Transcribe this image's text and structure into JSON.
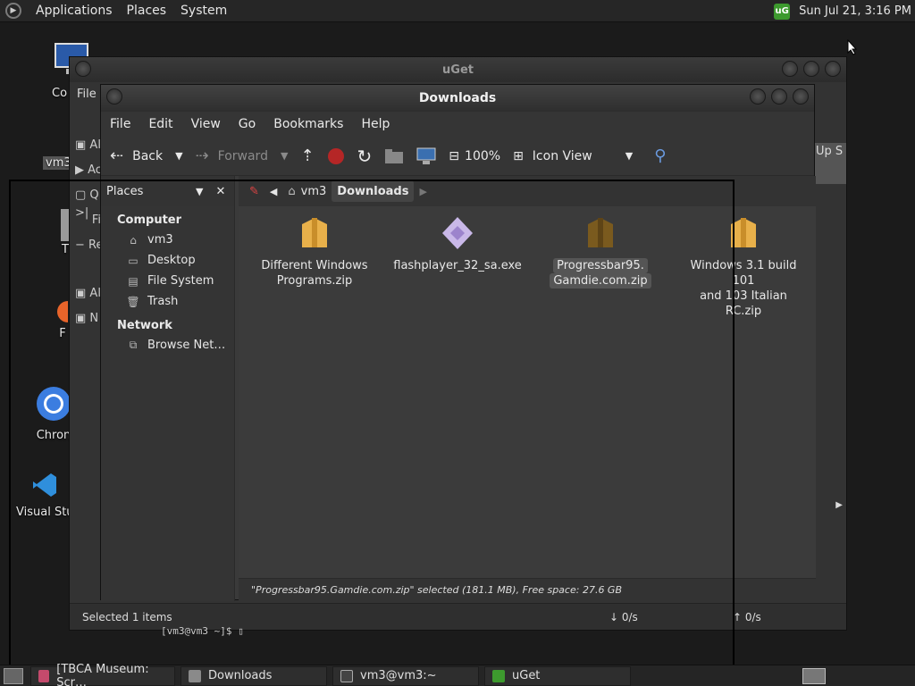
{
  "top_panel": {
    "menus": [
      "Applications",
      "Places",
      "System"
    ],
    "datetime": "Sun Jul 21,  3:16 PM",
    "tray_icon": "uget-icon"
  },
  "desktop": {
    "icons": [
      {
        "label": "Co",
        "icon": "computer-icon"
      },
      {
        "label": "vm3",
        "icon": "home-folder-icon"
      },
      {
        "label": "T",
        "icon": "trash-icon"
      },
      {
        "label": "F",
        "icon": "firefox-icon"
      },
      {
        "label": "Chron",
        "icon": "chrome-icon"
      },
      {
        "label": "Visual Stu",
        "icon": "vscode-icon"
      }
    ]
  },
  "uget": {
    "title": "uGet",
    "menu_file": "File",
    "side_labels": [
      "Al",
      "Ac",
      "Q",
      "Fi",
      "Re",
      "Al",
      "N"
    ],
    "up_label": "Up S",
    "status_left": "Selected 1 items",
    "down_rate": "↓  0/s",
    "up_rate": "↑  0/s"
  },
  "downloads": {
    "title": "Downloads",
    "menu": [
      "File",
      "Edit",
      "View",
      "Go",
      "Bookmarks",
      "Help"
    ],
    "toolbar": {
      "back": "Back",
      "forward": "Forward",
      "zoom": "100%",
      "view_mode": "Icon View"
    },
    "sidebar": {
      "header": "Places",
      "computer_heading": "Computer",
      "computer_items": [
        "vm3",
        "Desktop",
        "File System",
        "Trash"
      ],
      "network_heading": "Network",
      "network_items": [
        "Browse Net…"
      ]
    },
    "breadcrumbs": [
      "vm3",
      "Downloads"
    ],
    "files": [
      {
        "name_line1": "Different Windows",
        "name_line2": "Programs.zip",
        "icon": "archive-icon",
        "selected": false
      },
      {
        "name_line1": "flashplayer_32_sa.exe",
        "name_line2": "",
        "icon": "executable-icon",
        "selected": false
      },
      {
        "name_line1": "Progressbar95.",
        "name_line2": "Gamdie.com.zip",
        "icon": "archive-icon",
        "selected": true
      },
      {
        "name_line1": "Windows 3.1 build 101",
        "name_line2": "and 103 Italian RC.zip",
        "icon": "archive-icon",
        "selected": false
      }
    ],
    "status": "\"Progressbar95.Gamdie.com.zip\" selected (181.1 MB), Free space: 27.6 GB"
  },
  "terminal_prompt": "[vm3@vm3 ~]$",
  "taskbar": {
    "items": [
      "[TBCA Museum: Scr…",
      "Downloads",
      "vm3@vm3:~",
      "uGet"
    ]
  },
  "colors": {
    "archive": "#e8b04a",
    "archive_selected": "#7a5a1e",
    "uget_green": "#3d9a2e"
  }
}
